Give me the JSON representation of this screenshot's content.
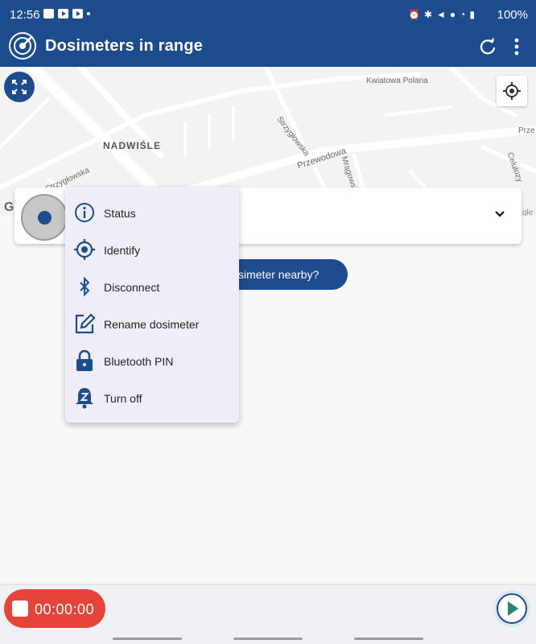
{
  "status_bar": {
    "time": "12:56",
    "battery": "100%"
  },
  "app_bar": {
    "title": "Dosimeters in range"
  },
  "map": {
    "district": "NADWIŚLE",
    "streets": [
      "Kwiatowa Polana",
      "Strzygłowska",
      "Przewodowa",
      "Mrągowska",
      "Celulozy",
      "Strzygłowska",
      "Prze"
    ]
  },
  "nearby_button": {
    "label": "simeter nearby?"
  },
  "menu": {
    "items": [
      {
        "label": "Status",
        "icon": "info-icon"
      },
      {
        "label": "Identify",
        "icon": "target-icon"
      },
      {
        "label": "Disconnect",
        "icon": "bluetooth-icon"
      },
      {
        "label": "Rename dosimeter",
        "icon": "edit-icon"
      },
      {
        "label": "Bluetooth PIN",
        "icon": "lock-icon"
      },
      {
        "label": "Turn off",
        "icon": "bell-z-icon"
      }
    ]
  },
  "recording": {
    "timer": "00:00:00"
  },
  "colors": {
    "primary": "#1c4c8e",
    "record": "#e6443b",
    "play": "#1e8a6a",
    "menu_bg": "#efeef8"
  }
}
